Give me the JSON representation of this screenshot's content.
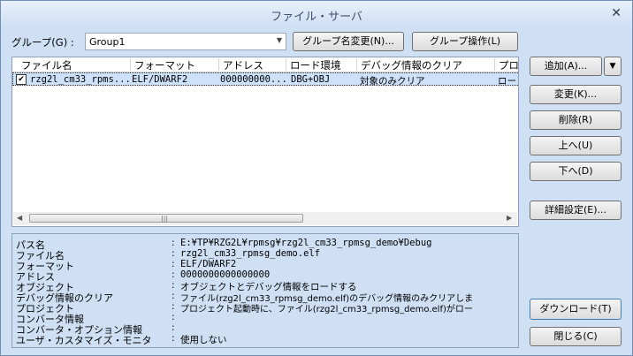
{
  "window": {
    "title": "ファイル・サーバ"
  },
  "group": {
    "label": "グループ(G) :",
    "value": "Group1",
    "rename_button": "グループ名変更(N)...",
    "ops_button": "グループ操作(L)"
  },
  "list": {
    "columns": [
      "ファイル名",
      "フォーマット",
      "アドレス",
      "ロード環境",
      "デバッグ情報のクリア",
      "プロ"
    ],
    "rows": [
      {
        "checked": true,
        "cells": [
          "rzg2l_cm33_rpms...",
          "ELF/DWARF2",
          "000000000...",
          "DBG+OBJ",
          "対象のみクリア",
          "ロー"
        ]
      }
    ]
  },
  "details": [
    {
      "key": "パス名",
      "value": "E:¥TP¥RZG2L¥rpmsg¥rzg2l_cm33_rpmsg_demo¥Debug"
    },
    {
      "key": "ファイル名",
      "value": "rzg2l_cm33_rpmsg_demo.elf"
    },
    {
      "key": "フォーマット",
      "value": "ELF/DWARF2"
    },
    {
      "key": "アドレス",
      "value": "0000000000000000"
    },
    {
      "key": "オブジェクト",
      "value": "オブジェクトとデバッグ情報をロードする"
    },
    {
      "key": "デバッグ情報のクリア",
      "value": "ファイル(rzg2l_cm33_rpmsg_demo.elf)のデバッグ情報のみクリアしま"
    },
    {
      "key": "プロジェクト",
      "value": "プロジェクト起動時に、ファイル(rzg2l_cm33_rpmsg_demo.elf)がロー"
    },
    {
      "key": "コンバータ情報",
      "value": ""
    },
    {
      "key": "コンバータ・オプション情報",
      "value": ""
    },
    {
      "key": "ユーザ・カスタマイズ・モニタ",
      "value": "使用しない"
    }
  ],
  "buttons": {
    "add": "追加(A)...",
    "change": "変更(K)...",
    "delete": "削除(R)",
    "up": "上へ(U)",
    "down": "下へ(D)",
    "detail": "詳細設定(E)...",
    "download": "ダウンロード(T)",
    "close": "閉じる(C)"
  },
  "icons": {
    "close": "close-icon",
    "dropdown": "chevron-down-icon",
    "check": "check-icon"
  }
}
